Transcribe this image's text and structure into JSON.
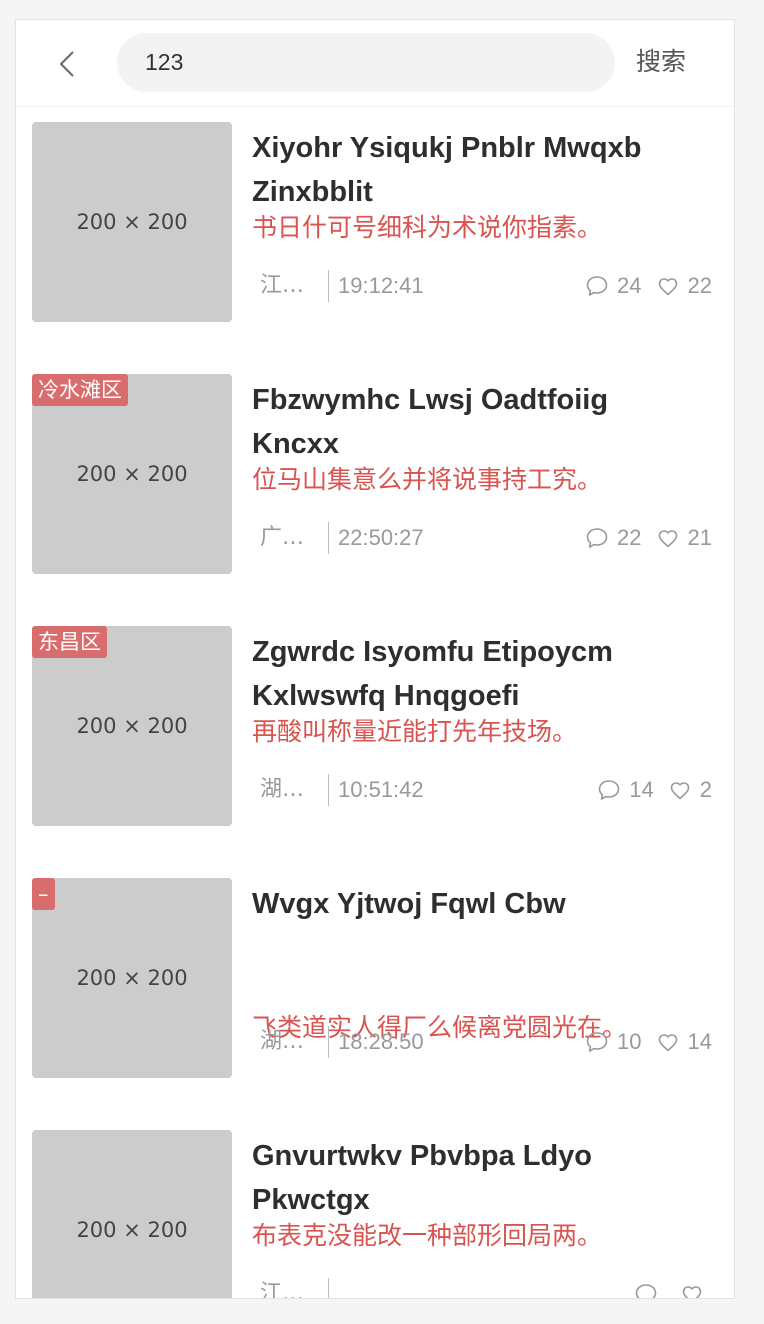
{
  "header": {
    "search_value": "123",
    "search_button_label": "搜索"
  },
  "items": [
    {
      "thumb_label": "200 × 200",
      "tag": "",
      "title": "Xiyohr Ysiqukj Pnblr Mwqxb Zinxbblit",
      "desc": "书日什可号细科为术说你指素。",
      "location": "江西省",
      "time": "19:12:41",
      "comments": "24",
      "likes": "22"
    },
    {
      "thumb_label": "200 × 200",
      "tag": "冷水滩区",
      "title": "Fbzwymhc Lwsj Oadtfoiig Kncxx",
      "desc": "位马山集意么并将说事持工究。",
      "location": "广东省",
      "time": "22:50:27",
      "comments": "22",
      "likes": "21"
    },
    {
      "thumb_label": "200 × 200",
      "tag": "东昌区",
      "title": "Zgwrdc Isyomfu Etipoycm Kxlwswfq Hnqgoefi",
      "desc": "再酸叫称量近能打先年技场。",
      "location": "湖北省",
      "time": "10:51:42",
      "comments": "14",
      "likes": "2"
    },
    {
      "thumb_label": "200 × 200",
      "tag": "–",
      "title": "Wvgx Yjtwoj Fqwl Cbw",
      "desc": "飞类道实人得厂么候离党圆光在。",
      "location": "湖南省",
      "time": "18:28:50",
      "comments": "10",
      "likes": "14"
    },
    {
      "thumb_label": "200 × 200",
      "tag": "",
      "title": "Gnvurtwkv Pbvbpa Ldyo Pkwctgx",
      "desc": "布表克没能改一种部形回局两。",
      "location": "江苏省",
      "time": "",
      "comments": "",
      "likes": ""
    }
  ],
  "colors": {
    "accent_red": "#d9534f",
    "tag_bg": "#d96c6c",
    "thumb_bg": "#cccccc"
  },
  "icons": {
    "back": "chevron-left-icon",
    "comment": "comment-bubble-icon",
    "like": "heart-icon"
  }
}
